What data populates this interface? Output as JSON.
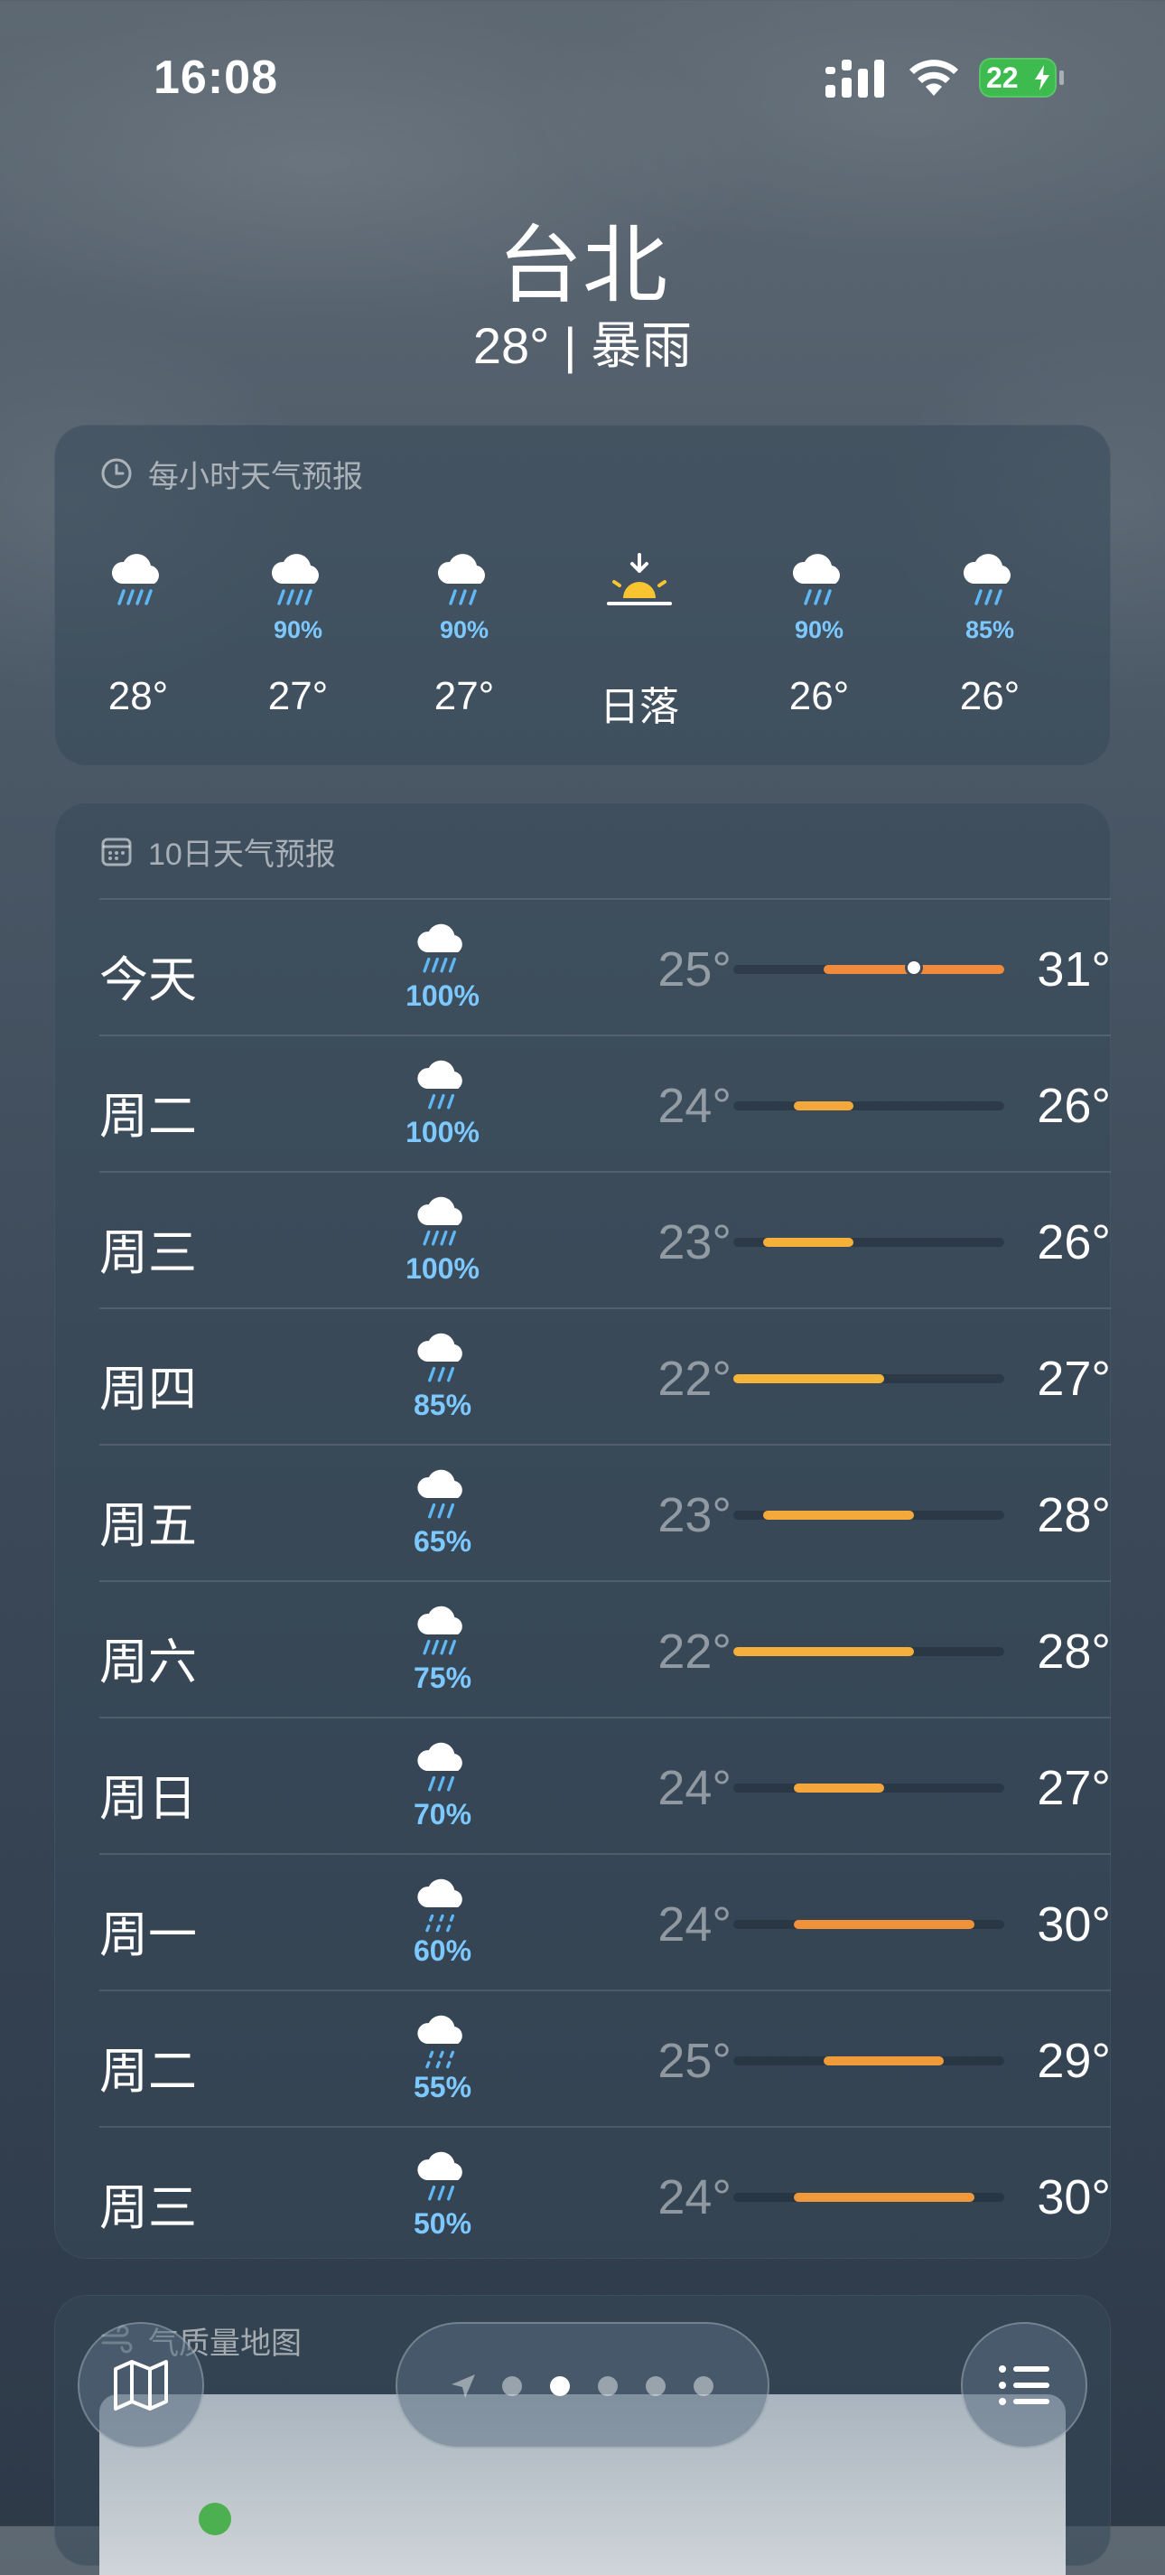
{
  "status_bar": {
    "time": "16:08",
    "battery": "22"
  },
  "header": {
    "city": "台北",
    "condition": "28° | 暴雨"
  },
  "hourly": {
    "title": "每小时天气预报",
    "items": [
      {
        "icon": "heavy-rain-icon",
        "pct": "",
        "temp": "28°"
      },
      {
        "icon": "heavy-rain-icon",
        "pct": "90%",
        "temp": "27°"
      },
      {
        "icon": "rain-icon",
        "pct": "90%",
        "temp": "27°"
      },
      {
        "icon": "sunset-icon",
        "pct": "",
        "temp": "日落"
      },
      {
        "icon": "rain-icon",
        "pct": "90%",
        "temp": "26°"
      },
      {
        "icon": "rain-icon",
        "pct": "85%",
        "temp": "26°"
      }
    ]
  },
  "daily": {
    "title": "10日天气预报",
    "range_min": 22,
    "range_max": 31,
    "days": [
      {
        "day": "今天",
        "icon": "heavy-rain-icon",
        "pct": "100%",
        "low": "25°",
        "high": "31°",
        "lo_v": 25,
        "hi_v": 31,
        "current": 28,
        "color": "#f08a3c"
      },
      {
        "day": "周二",
        "icon": "rain-icon",
        "pct": "100%",
        "low": "24°",
        "high": "26°",
        "lo_v": 24,
        "hi_v": 26,
        "color": "#f4a83c"
      },
      {
        "day": "周三",
        "icon": "heavy-rain-icon",
        "pct": "100%",
        "low": "23°",
        "high": "26°",
        "lo_v": 23,
        "hi_v": 26,
        "color": "#f4b038"
      },
      {
        "day": "周四",
        "icon": "rain-icon",
        "pct": "85%",
        "low": "22°",
        "high": "27°",
        "lo_v": 22,
        "hi_v": 27,
        "color": "#f4b53a"
      },
      {
        "day": "周五",
        "icon": "rain-icon",
        "pct": "65%",
        "low": "23°",
        "high": "28°",
        "lo_v": 23,
        "hi_v": 28,
        "color": "#f4aa3a"
      },
      {
        "day": "周六",
        "icon": "heavy-rain-icon",
        "pct": "75%",
        "low": "22°",
        "high": "28°",
        "lo_v": 22,
        "hi_v": 28,
        "color": "#f4b03a"
      },
      {
        "day": "周日",
        "icon": "rain-icon",
        "pct": "70%",
        "low": "24°",
        "high": "27°",
        "lo_v": 24,
        "hi_v": 27,
        "color": "#f4a63c"
      },
      {
        "day": "周一",
        "icon": "drizzle-icon",
        "pct": "60%",
        "low": "24°",
        "high": "30°",
        "lo_v": 24,
        "hi_v": 30,
        "color": "#f0923a"
      },
      {
        "day": "周二",
        "icon": "drizzle-icon",
        "pct": "55%",
        "low": "25°",
        "high": "29°",
        "lo_v": 25,
        "hi_v": 29,
        "color": "#f09a3a"
      },
      {
        "day": "周三",
        "icon": "rain-icon",
        "pct": "50%",
        "low": "24°",
        "high": "30°",
        "lo_v": 24,
        "hi_v": 30,
        "color": "#f0983a"
      }
    ]
  },
  "air_quality": {
    "title": "气质量地图"
  },
  "nav": {
    "pages": 5,
    "active_page": 1
  }
}
